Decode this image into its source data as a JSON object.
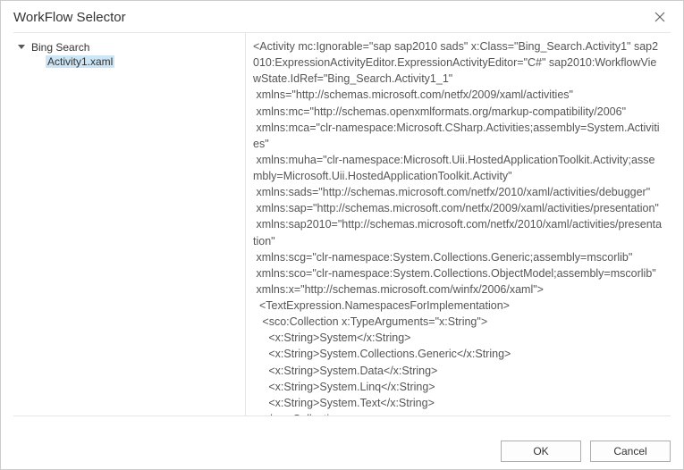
{
  "title": "WorkFlow Selector",
  "tree": {
    "root_label": "Bing Search",
    "child_label": "Activity1.xaml"
  },
  "xaml_content": "<Activity mc:Ignorable=\"sap sap2010 sads\" x:Class=\"Bing_Search.Activity1\" sap2010:ExpressionActivityEditor.ExpressionActivityEditor=\"C#\" sap2010:WorkflowViewState.IdRef=\"Bing_Search.Activity1_1\"\n xmlns=\"http://schemas.microsoft.com/netfx/2009/xaml/activities\"\n xmlns:mc=\"http://schemas.openxmlformats.org/markup-compatibility/2006\"\n xmlns:mca=\"clr-namespace:Microsoft.CSharp.Activities;assembly=System.Activities\"\n xmlns:muha=\"clr-namespace:Microsoft.Uii.HostedApplicationToolkit.Activity;assembly=Microsoft.Uii.HostedApplicationToolkit.Activity\"\n xmlns:sads=\"http://schemas.microsoft.com/netfx/2010/xaml/activities/debugger\"\n xmlns:sap=\"http://schemas.microsoft.com/netfx/2009/xaml/activities/presentation\"\n xmlns:sap2010=\"http://schemas.microsoft.com/netfx/2010/xaml/activities/presentation\"\n xmlns:scg=\"clr-namespace:System.Collections.Generic;assembly=mscorlib\"\n xmlns:sco=\"clr-namespace:System.Collections.ObjectModel;assembly=mscorlib\"\n xmlns:x=\"http://schemas.microsoft.com/winfx/2006/xaml\">\n  <TextExpression.NamespacesForImplementation>\n   <sco:Collection x:TypeArguments=\"x:String\">\n     <x:String>System</x:String>\n     <x:String>System.Collections.Generic</x:String>\n     <x:String>System.Data</x:String>\n     <x:String>System.Linq</x:String>\n     <x:String>System.Text</x:String>\n   </sco:Collection>",
  "buttons": {
    "ok_label": "OK",
    "cancel_label": "Cancel"
  }
}
